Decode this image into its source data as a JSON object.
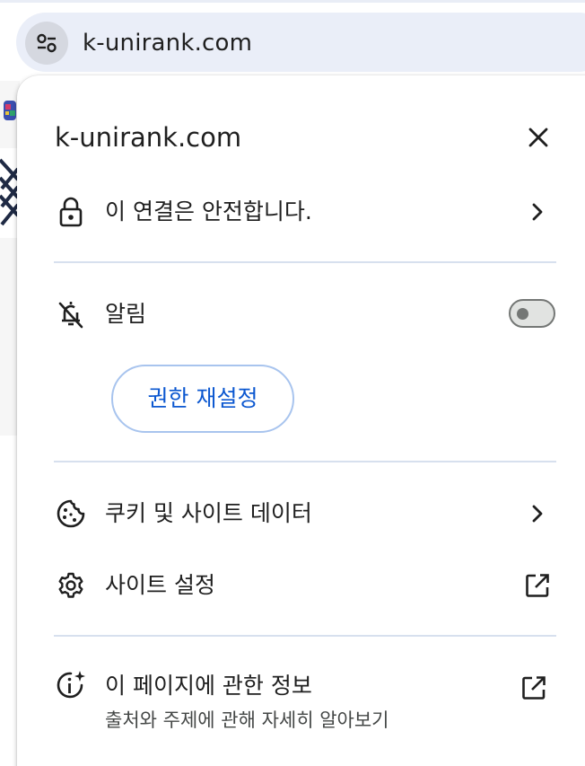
{
  "address_bar": {
    "url": "k-unirank.com",
    "site_info_icon": "tune-icon"
  },
  "popup": {
    "title": "k-unirank.com",
    "close_icon": "close-icon",
    "connection": {
      "label": "이 연결은 안전합니다.",
      "icon": "lock-icon"
    },
    "notifications": {
      "label": "알림",
      "icon": "notifications-off-icon",
      "enabled": false
    },
    "reset_permissions_label": "권한 재설정",
    "cookies": {
      "label": "쿠키 및 사이트 데이터",
      "icon": "cookie-icon"
    },
    "site_settings": {
      "label": "사이트 설정",
      "icon": "gear-icon"
    },
    "about_page": {
      "label": "이 페이지에 관한 정보",
      "sublabel": "출처와 주제에 관해 자세히 알아보기",
      "icon": "info-sparkle-icon"
    }
  },
  "colors": {
    "accent": "#0b57d0",
    "address_bar_bg": "#eaeef8",
    "divider": "#d7e0ee",
    "button_border": "#a8c4ee"
  }
}
